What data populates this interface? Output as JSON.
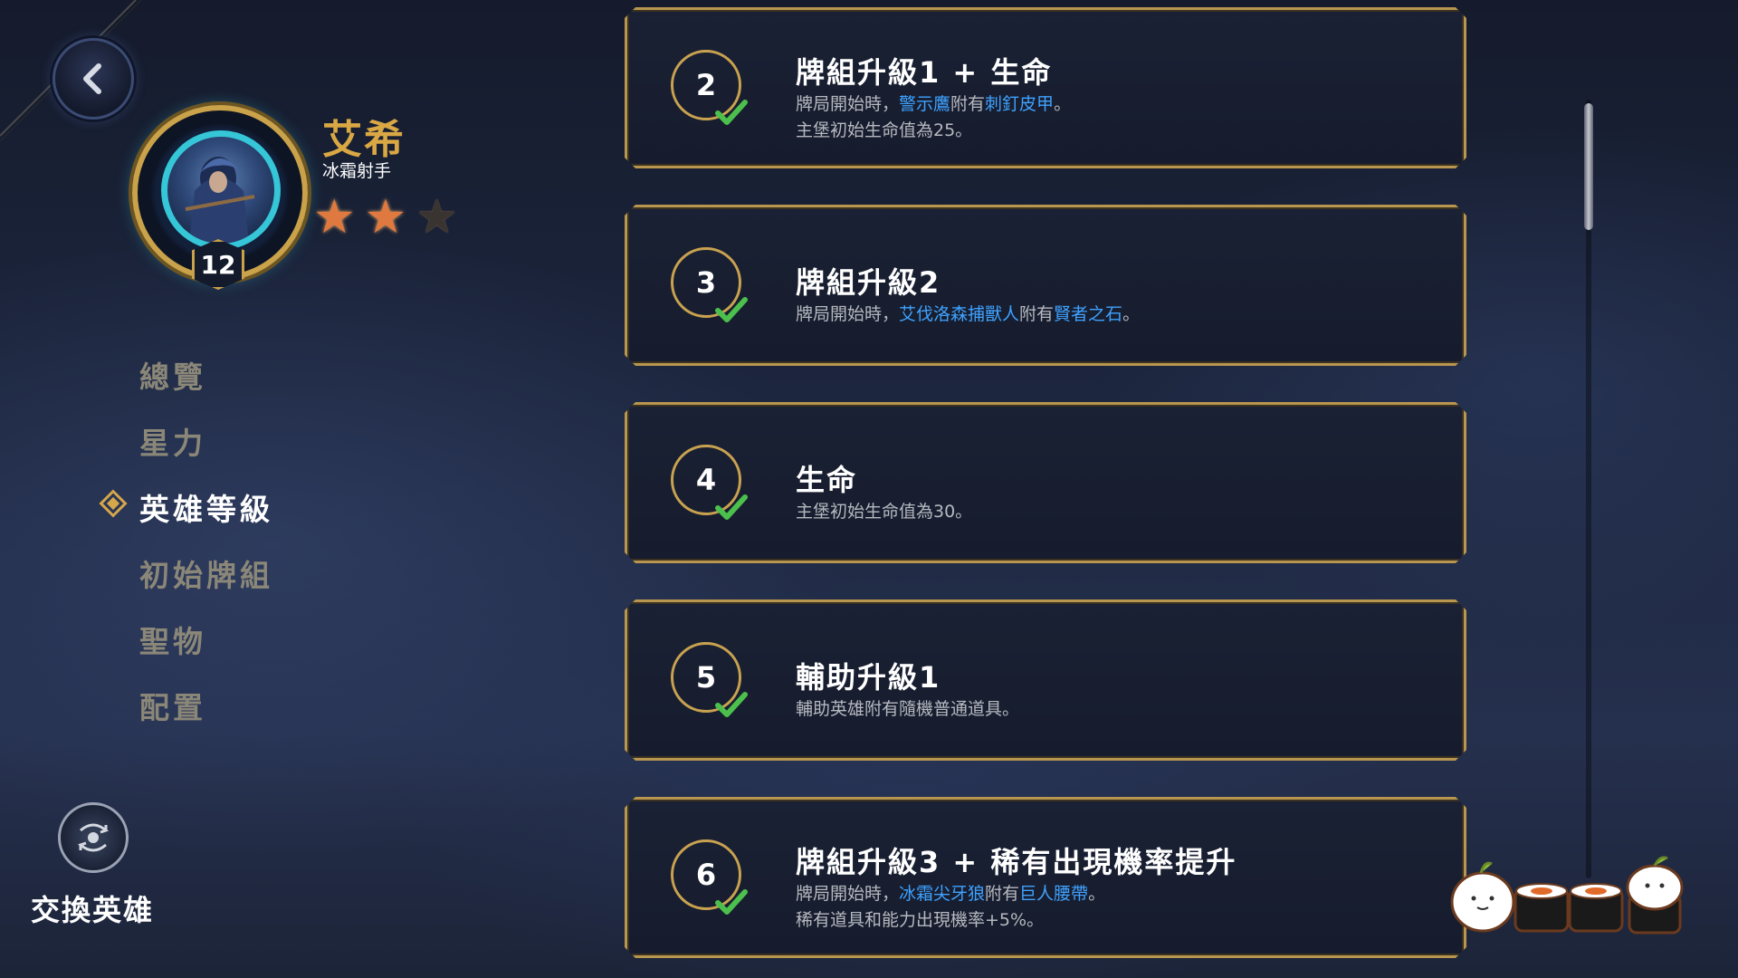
{
  "hero": {
    "name": "艾希",
    "title": "冰霜射手",
    "level": "12",
    "stars_filled": 2,
    "stars_total": 3
  },
  "nav": {
    "items": [
      {
        "label": "總覽",
        "active": false
      },
      {
        "label": "星力",
        "active": false
      },
      {
        "label": "英雄等級",
        "active": true
      },
      {
        "label": "初始牌組",
        "active": false
      },
      {
        "label": "聖物",
        "active": false
      },
      {
        "label": "配置",
        "active": false
      }
    ]
  },
  "swap": {
    "label": "交換英雄"
  },
  "levels": [
    {
      "level": "2",
      "title": "牌組升級1 + 生命",
      "lines": [
        [
          {
            "t": "牌局開始時，"
          },
          {
            "t": "警示鷹",
            "hl": true
          },
          {
            "t": "附有"
          },
          {
            "t": "刺釘皮甲",
            "hl": true
          },
          {
            "t": "。"
          }
        ],
        [
          {
            "t": "主堡初始生命值為25。"
          }
        ]
      ]
    },
    {
      "level": "3",
      "title": "牌組升級2",
      "lines": [
        [
          {
            "t": "牌局開始時，"
          },
          {
            "t": "艾伐洛森捕獸人",
            "hl": true
          },
          {
            "t": "附有"
          },
          {
            "t": "賢者之石",
            "hl": true
          },
          {
            "t": "。"
          }
        ]
      ]
    },
    {
      "level": "4",
      "title": "生命",
      "lines": [
        [
          {
            "t": "主堡初始生命值為30。"
          }
        ]
      ]
    },
    {
      "level": "5",
      "title": "輔助升級1",
      "lines": [
        [
          {
            "t": "輔助英雄附有隨機普通道具。"
          }
        ]
      ]
    },
    {
      "level": "6",
      "title": "牌組升級3 + 稀有出現機率提升",
      "lines": [
        [
          {
            "t": "牌局開始時，"
          },
          {
            "t": "冰霜尖牙狼",
            "hl": true
          },
          {
            "t": "附有"
          },
          {
            "t": "巨人腰帶",
            "hl": true
          },
          {
            "t": "。"
          }
        ],
        [
          {
            "t": "稀有道具和能力出現機率+5%。"
          }
        ]
      ]
    }
  ],
  "colors": {
    "gold": "#d9a844",
    "highlight": "#3fa2ff",
    "check": "#4cc04c"
  }
}
